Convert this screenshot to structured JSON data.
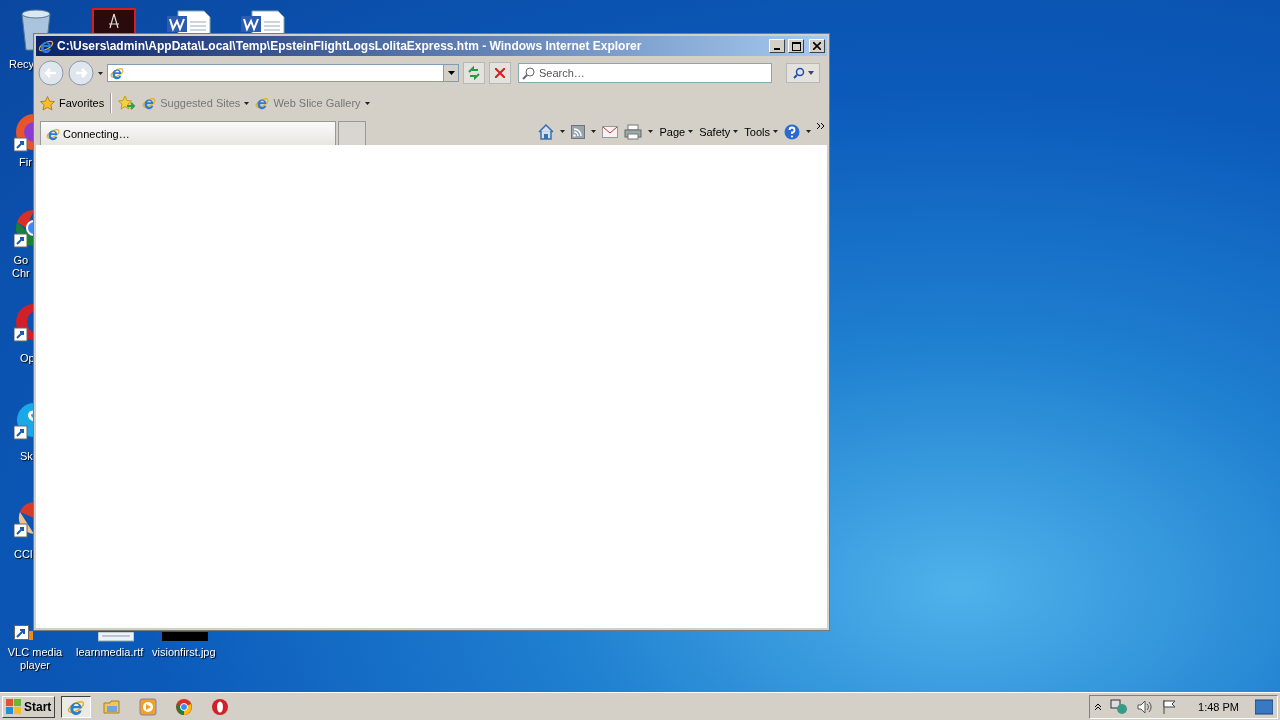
{
  "desktop": {
    "icons": [
      {
        "kind": "recycle",
        "label": "Recy"
      },
      {
        "kind": "pdf"
      },
      {
        "kind": "word"
      },
      {
        "kind": "word"
      },
      {
        "kind": "firefox",
        "label": "Fir"
      },
      {
        "kind": "chrome",
        "label": "Go Chr"
      },
      {
        "kind": "opera",
        "label": "Op"
      },
      {
        "kind": "skype",
        "label": "Sk"
      },
      {
        "kind": "ccleaner",
        "label": "CCl"
      },
      {
        "kind": "vlc",
        "label": "VLC media player"
      },
      {
        "kind": "rtf",
        "label": "learnmedia.rtf"
      },
      {
        "kind": "jpg",
        "label": "visionfirst.jpg"
      }
    ]
  },
  "window": {
    "title": "C:\\Users\\admin\\AppData\\Local\\Temp\\EpsteinFlightLogsLolitaExpress.htm - Windows Internet Explorer",
    "search": {
      "placeholder": "Search…"
    },
    "favorites_bar": {
      "favorites": "Favorites",
      "links": [
        "Suggested Sites",
        "Web Slice Gallery"
      ]
    },
    "tab": {
      "title": "Connecting…"
    },
    "command_bar": [
      "Page",
      "Safety",
      "Tools"
    ]
  },
  "taskbar": {
    "start": "Start",
    "apps": [
      {
        "kind": "ie",
        "selected": true
      },
      {
        "kind": "folder",
        "selected": false
      },
      {
        "kind": "player",
        "selected": false
      },
      {
        "kind": "chrome",
        "selected": false
      },
      {
        "kind": "opera",
        "selected": false
      }
    ],
    "clock": "1:48 PM"
  }
}
